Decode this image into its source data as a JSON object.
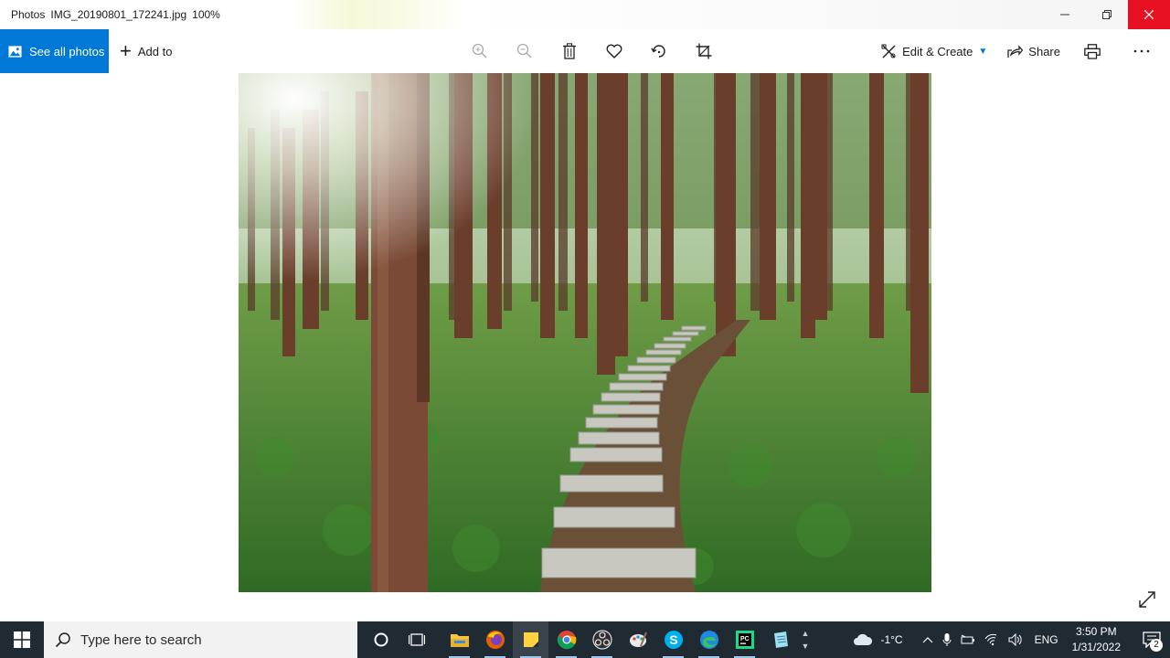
{
  "window": {
    "app_name": "Photos",
    "file_name": "IMG_20190801_172241.jpg",
    "zoom": "100%"
  },
  "toolbar": {
    "see_all_photos": "See all photos",
    "add_to": "Add to",
    "edit_create": "Edit & Create",
    "share": "Share",
    "icons": [
      "zoom-in-icon",
      "zoom-out-icon",
      "delete-icon",
      "heart-icon",
      "rotate-icon",
      "crop-icon",
      "print-icon",
      "more-icon"
    ]
  },
  "colors": {
    "accent": "#0078d7",
    "close": "#e81123",
    "taskbar": "#1f2a33"
  },
  "taskbar": {
    "search_placeholder": "Type here to search",
    "weather": "-1°C",
    "language": "ENG",
    "time": "3:50 PM",
    "date": "1/31/2022",
    "notifications": "2",
    "apps": [
      "task-view-icon",
      "file-explorer-icon",
      "firefox-icon",
      "sticky-notes-icon",
      "chrome-icon",
      "obs-icon",
      "paint-icon",
      "skype-icon",
      "edge-icon",
      "pycharm-icon",
      "notepad-icon"
    ]
  }
}
